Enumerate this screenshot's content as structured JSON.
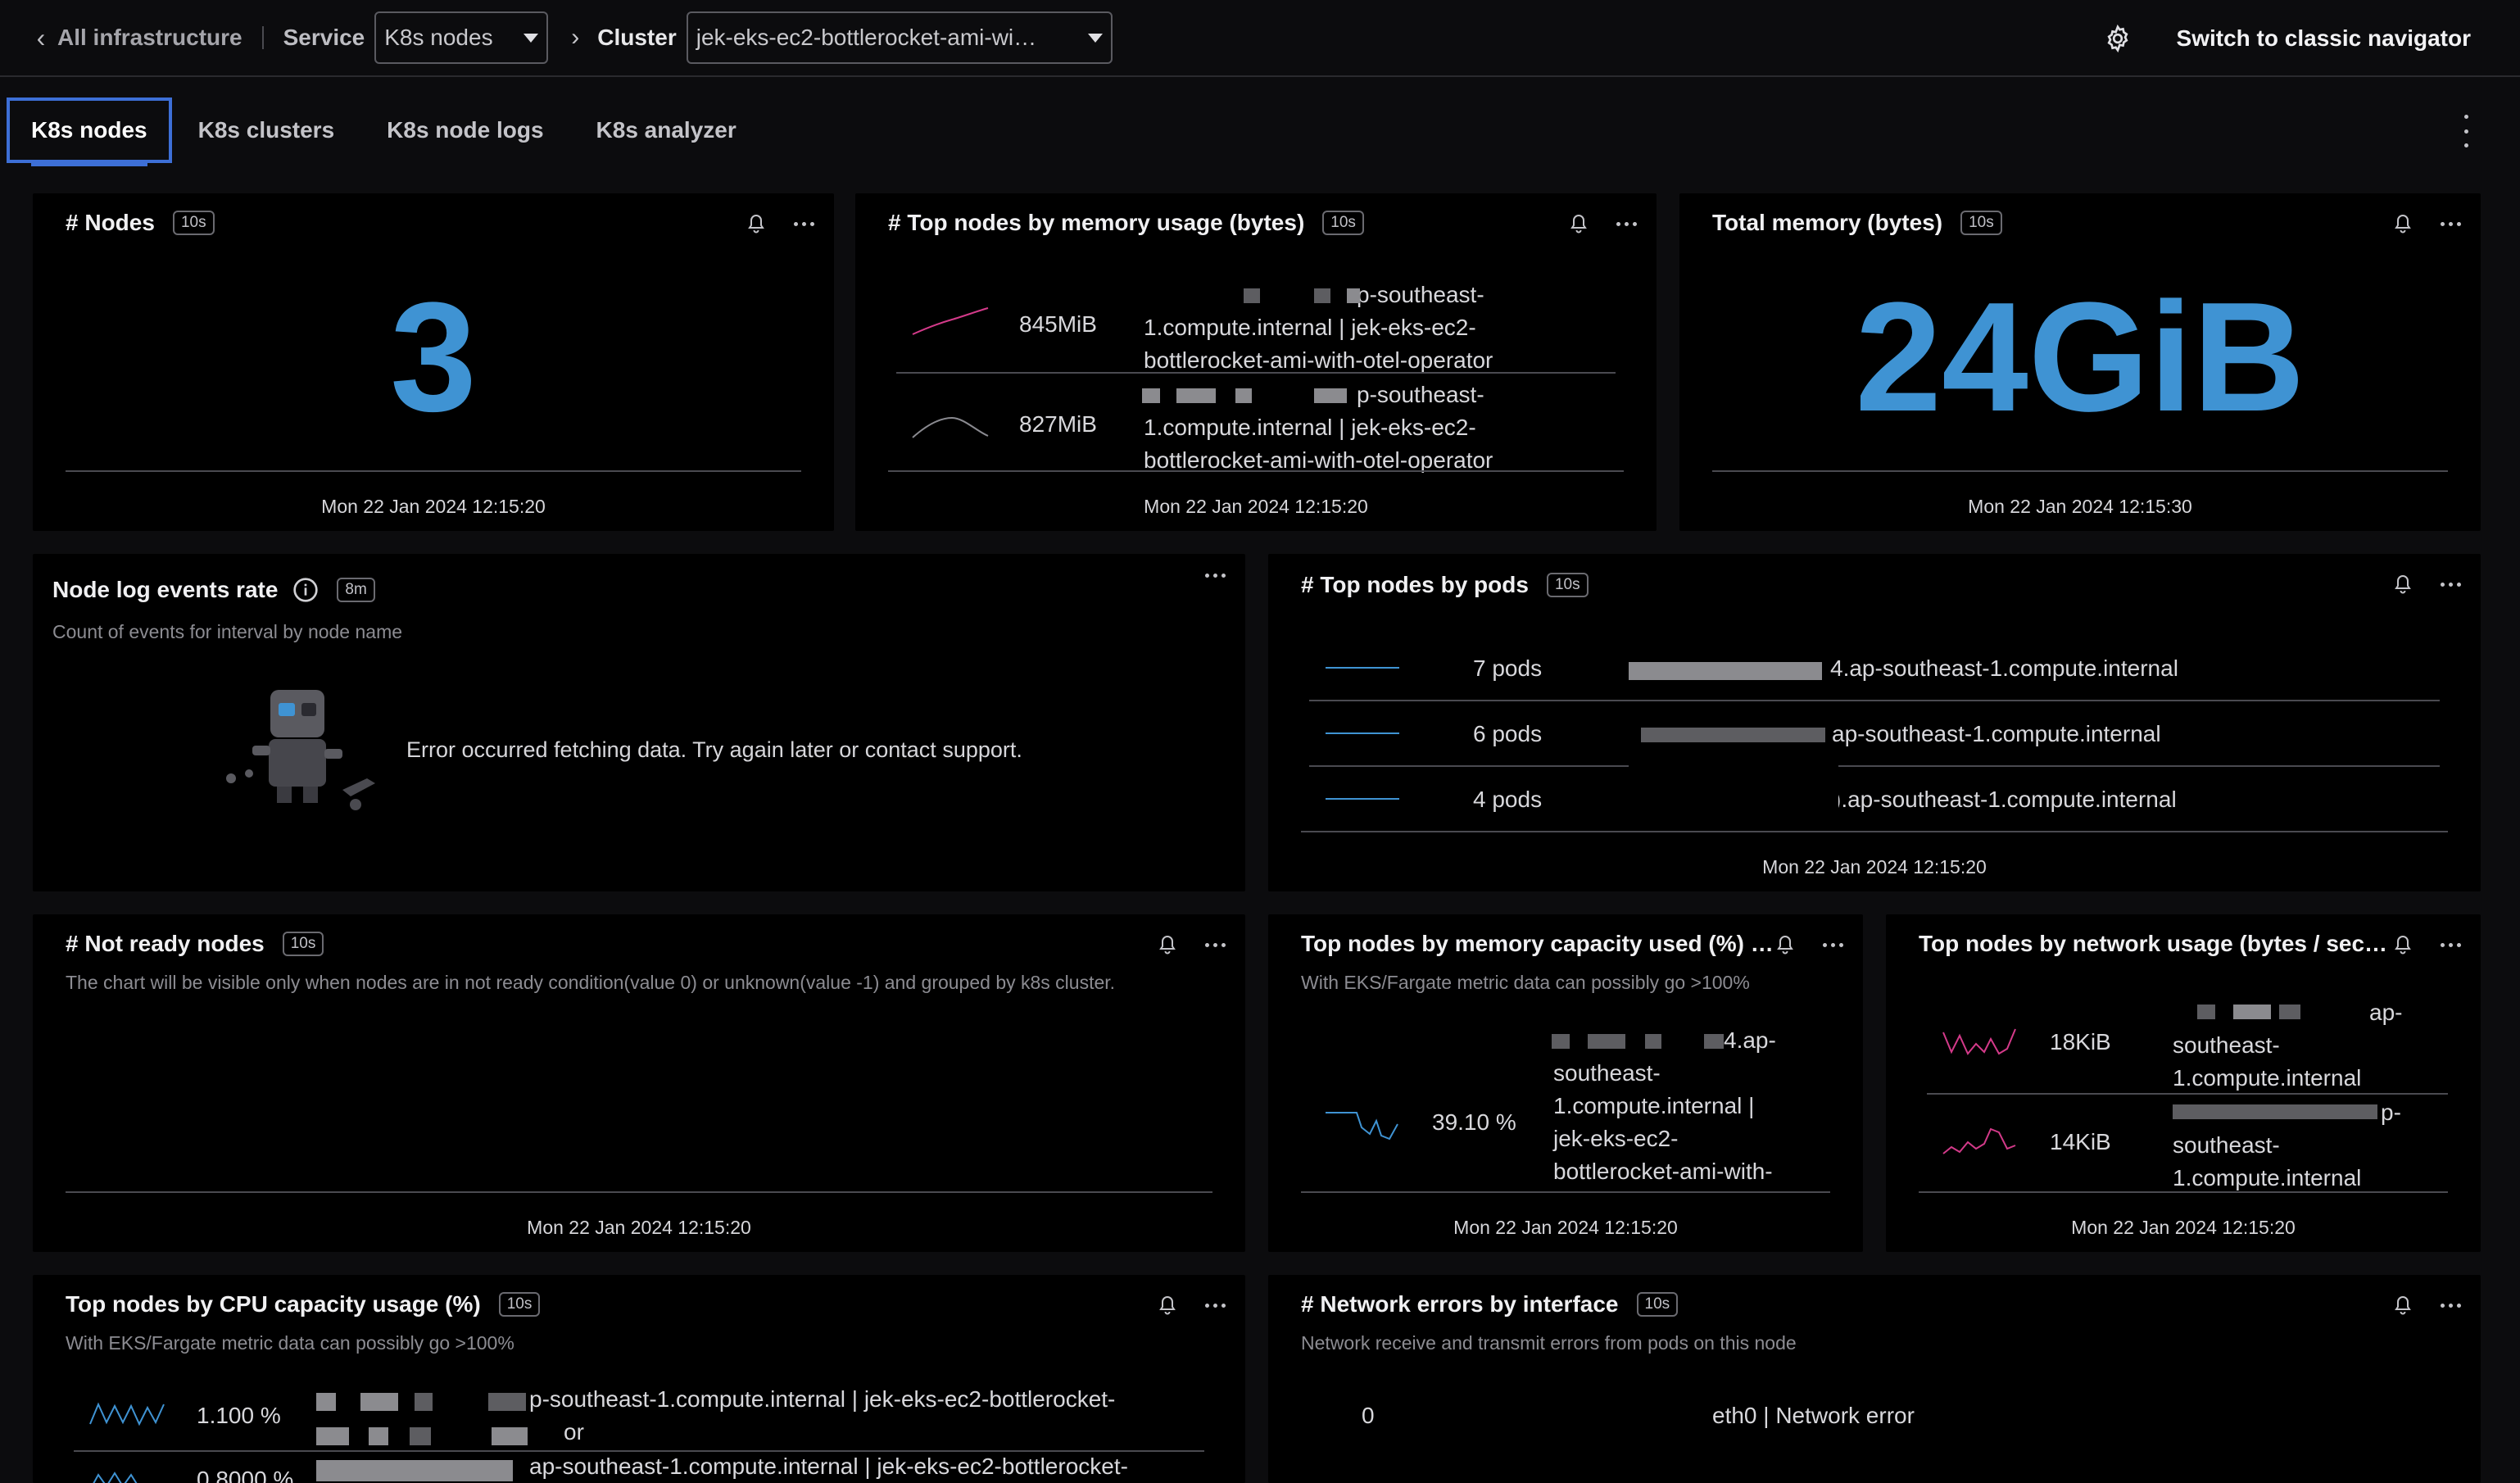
{
  "nav": {
    "back_label": "All infrastructure",
    "service_label": "Service",
    "service_value": "K8s nodes",
    "cluster_label": "Cluster",
    "cluster_value": "jek-eks-ec2-bottlerocket-ami-wi…",
    "classic_label": "Switch to classic navigator"
  },
  "tabs": [
    "K8s nodes",
    "K8s clusters",
    "K8s node logs",
    "K8s analyzer"
  ],
  "panels": {
    "nodes": {
      "title": "# Nodes",
      "badge": "10s",
      "value": "3",
      "timestamp": "Mon 22 Jan 2024 12:15:20"
    },
    "top_mem": {
      "title": "# Top nodes by memory usage (bytes)",
      "badge": "10s",
      "rows": [
        {
          "value": "845MiB",
          "l1": "p-southeast-",
          "l2": "1.compute.internal | jek-eks-ec2-",
          "l3": "bottlerocket-ami-with-otel-operator"
        },
        {
          "value": "827MiB",
          "l1": "p-southeast-",
          "l2": "1.compute.internal | jek-eks-ec2-",
          "l3": "bottlerocket-ami-with-otel-operator"
        }
      ],
      "timestamp": "Mon 22 Jan 2024 12:15:20"
    },
    "total_mem": {
      "title": "Total memory (bytes)",
      "badge": "10s",
      "value": "24GiB",
      "timestamp": "Mon 22 Jan 2024 12:15:30"
    },
    "log_rate": {
      "title": "Node log events rate",
      "badge": "8m",
      "subtitle": "Count of events for interval by node name",
      "error": "Error occurred fetching data. Try again later or contact support."
    },
    "top_pods": {
      "title": "# Top nodes by pods",
      "badge": "10s",
      "rows": [
        {
          "value": "7 pods",
          "name": "4.ap-southeast-1.compute.internal"
        },
        {
          "value": "6 pods",
          "name": "ap-southeast-1.compute.internal"
        },
        {
          "value": "4 pods",
          "name": ").ap-southeast-1.compute.internal"
        }
      ],
      "timestamp": "Mon 22 Jan 2024 12:15:20"
    },
    "not_ready": {
      "title": "# Not ready nodes",
      "badge": "10s",
      "subtitle": "The chart will be visible only when nodes are in not ready condition(value 0) or unknown(value -1) and grouped by k8s cluster.",
      "timestamp": "Mon 22 Jan 2024 12:15:20"
    },
    "mem_cap": {
      "title": "Top nodes by memory capacity used (%) …",
      "subtitle": "With EKS/Fargate metric data can possibly go >100%",
      "value": "39.10 %",
      "lines": [
        "4.ap-",
        "southeast-",
        "1.compute.internal |",
        "jek-eks-ec2-",
        "bottlerocket-ami-with-"
      ],
      "timestamp": "Mon 22 Jan 2024 12:15:20"
    },
    "net_usage": {
      "title": "Top nodes by network usage (bytes / sec…",
      "rows": [
        {
          "value": "18KiB",
          "l1": "ap-",
          "l2": "southeast-",
          "l3": "1.compute.internal"
        },
        {
          "value": "14KiB",
          "l1": "p-",
          "l2": "southeast-",
          "l3": "1.compute.internal"
        }
      ],
      "timestamp": "Mon 22 Jan 2024 12:15:20"
    },
    "cpu_cap": {
      "title": "Top nodes by CPU capacity usage (%)",
      "badge": "10s",
      "subtitle": "With EKS/Fargate metric data can possibly go >100%",
      "rows": [
        {
          "value": "1.100 %",
          "l1": "p-southeast-1.compute.internal | jek-eks-ec2-bottlerocket-",
          "l2": "or"
        },
        {
          "value": "0.8000 %",
          "l1": "ap-southeast-1.compute.internal | jek-eks-ec2-bottlerocket-"
        }
      ]
    },
    "net_err": {
      "title": "# Network errors by interface",
      "badge": "10s",
      "subtitle": "Network receive and transmit errors from pods on this node",
      "value": "0",
      "label": "eth0 | Network error"
    }
  },
  "colors": {
    "accent_blue": "#3f93d3",
    "accent_pink": "#d43a8a",
    "tab_focus": "#3d6fd6"
  }
}
